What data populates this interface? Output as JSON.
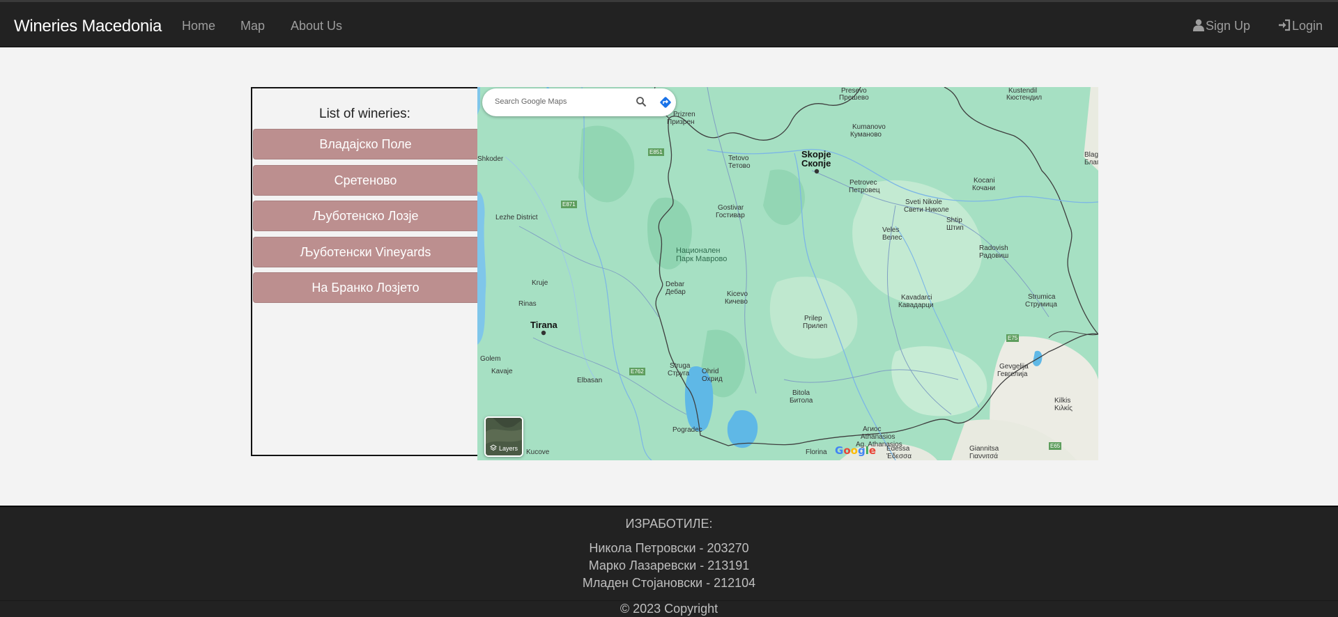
{
  "navbar": {
    "brand": "Wineries Macedonia",
    "links": [
      "Home",
      "Map",
      "About Us"
    ],
    "signup": "Sign Up",
    "login": "Login"
  },
  "panel": {
    "title": "List of wineries:",
    "wineries": [
      "Владајско Поле",
      "Сретеново",
      "Љуботенско Лозје",
      "Љуботенски Vineyards",
      "На Бранко Лозјето"
    ]
  },
  "map": {
    "search_placeholder": "Search Google Maps",
    "layers_label": "Layers",
    "logo": "Google",
    "labels": [
      {
        "text": "Skopje",
        "class": "city"
      },
      {
        "text": "Скопје",
        "class": "city"
      },
      {
        "text": "Tirana",
        "class": "city"
      },
      {
        "text": "Prizren"
      },
      {
        "text": "Призрен"
      },
      {
        "text": "Tetovo"
      },
      {
        "text": "Тетово"
      },
      {
        "text": "Kumanovo"
      },
      {
        "text": "Куманово"
      },
      {
        "text": "Shkoder"
      },
      {
        "text": "Lezhe District"
      },
      {
        "text": "Gostivar"
      },
      {
        "text": "Гостивар"
      },
      {
        "text": "Национален"
      },
      {
        "text": "Парк Маврово"
      },
      {
        "text": "Debar"
      },
      {
        "text": "Дебар"
      },
      {
        "text": "Kicevo"
      },
      {
        "text": "Кичево"
      },
      {
        "text": "Veles"
      },
      {
        "text": "Велес"
      },
      {
        "text": "Sveti Nikole"
      },
      {
        "text": "Свети Николе"
      },
      {
        "text": "Shtip"
      },
      {
        "text": "Штип"
      },
      {
        "text": "Kocani"
      },
      {
        "text": "Кочани"
      },
      {
        "text": "Radovish"
      },
      {
        "text": "Радовиш"
      },
      {
        "text": "Kavadarci"
      },
      {
        "text": "Кавадарци"
      },
      {
        "text": "Strumica"
      },
      {
        "text": "Струмица"
      },
      {
        "text": "Prilep"
      },
      {
        "text": "Прилеп"
      },
      {
        "text": "Struga"
      },
      {
        "text": "Струга"
      },
      {
        "text": "Ohrid"
      },
      {
        "text": "Охрид"
      },
      {
        "text": "Bitola"
      },
      {
        "text": "Битола"
      },
      {
        "text": "Elbasan"
      },
      {
        "text": "Gevgelija"
      },
      {
        "text": "Гевгелија"
      },
      {
        "text": "Kilkis"
      },
      {
        "text": "Κιλκίς"
      },
      {
        "text": "Edessa"
      },
      {
        "text": "Έδεσσα"
      },
      {
        "text": "Giannitsa"
      },
      {
        "text": "Γιαννιτσά"
      },
      {
        "text": "Florina"
      },
      {
        "text": "Pogradec"
      },
      {
        "text": "Kruje"
      },
      {
        "text": "Rinas"
      },
      {
        "text": "Kavaje"
      },
      {
        "text": "Golem"
      },
      {
        "text": "Petrovec"
      },
      {
        "text": "Петровец"
      },
      {
        "text": "Kustendil"
      },
      {
        "text": "Кюстендил"
      },
      {
        "text": "Presevo"
      },
      {
        "text": "Прешево"
      },
      {
        "text": "Blago"
      },
      {
        "text": "Благо"
      },
      {
        "text": "Kucove"
      },
      {
        "text": "Athanasios"
      },
      {
        "text": "Ag. Athanasios"
      },
      {
        "text": "Агиос"
      },
      {
        "text": "E65"
      },
      {
        "text": "E75"
      },
      {
        "text": "E871"
      },
      {
        "text": "E762"
      },
      {
        "text": "E851"
      }
    ]
  },
  "footer": {
    "heading": "ИЗРАБОТИЛЕ:",
    "members": [
      "Никола Петровски - 203270",
      "Марко Лазаревски - 213191",
      "Младен Стојановски - 212104"
    ],
    "copyright": "© 2023 Copyright"
  }
}
